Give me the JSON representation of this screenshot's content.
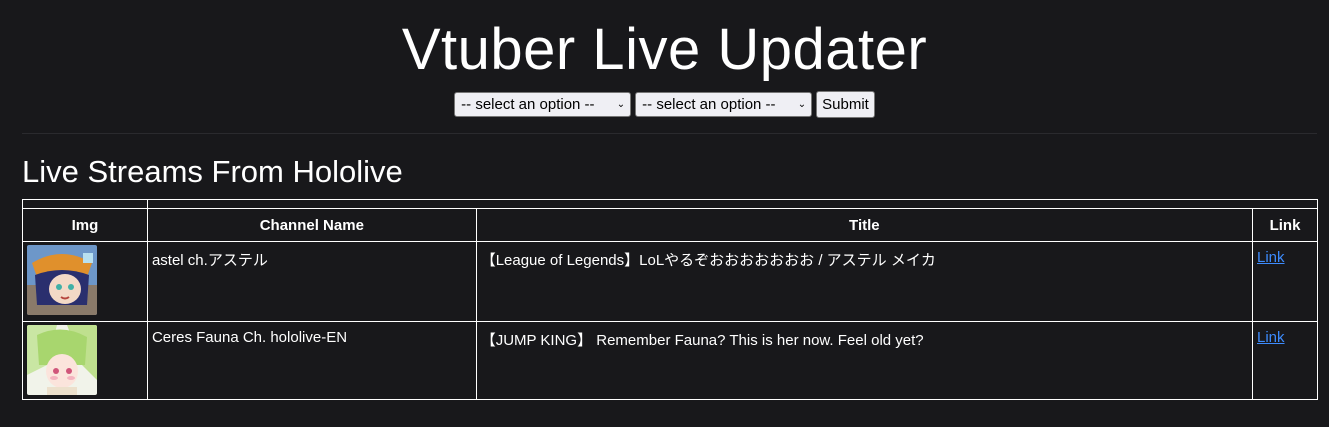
{
  "header": {
    "title": "Vtuber Live Updater"
  },
  "form": {
    "select1": {
      "selected": "-- select an option --"
    },
    "select2": {
      "selected": "-- select an option --"
    },
    "submit_label": "Submit"
  },
  "section": {
    "heading": "Live Streams From Hololive"
  },
  "table": {
    "headers": [
      "Img",
      "Channel Name",
      "Title",
      "Link"
    ],
    "rows": [
      {
        "channel": "astel ch.アステル",
        "title": "【League of Legends】LoLやるぞおおおおおおお / アステル メイカ",
        "link_label": "Link",
        "avatar_icon": "avatar-astel"
      },
      {
        "channel": "Ceres Fauna Ch. hololive-EN",
        "title": "【JUMP KING】 Remember Fauna? This is her now. Feel old yet?",
        "link_label": "Link",
        "avatar_icon": "avatar-fauna"
      }
    ]
  },
  "colors": {
    "background": "#18181b",
    "text": "#ffffff",
    "link": "#3d8bfd"
  }
}
